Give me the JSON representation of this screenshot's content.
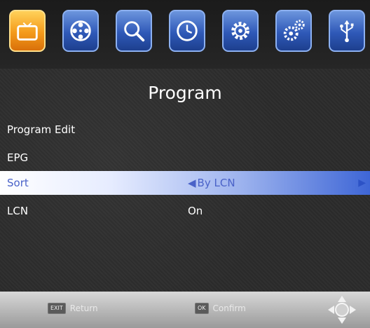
{
  "tabs": [
    {
      "icon": "tv-icon",
      "active": true
    },
    {
      "icon": "film-reel-icon",
      "active": false
    },
    {
      "icon": "search-icon",
      "active": false
    },
    {
      "icon": "clock-icon",
      "active": false
    },
    {
      "icon": "settings-gear-icon",
      "active": false
    },
    {
      "icon": "system-gears-icon",
      "active": false
    },
    {
      "icon": "usb-icon",
      "active": false
    }
  ],
  "menu": {
    "title": "Program",
    "items": [
      {
        "label": "Program Edit",
        "value": ""
      },
      {
        "label": "EPG",
        "value": ""
      },
      {
        "label": "Sort",
        "value": "By LCN"
      },
      {
        "label": "LCN",
        "value": "On"
      }
    ],
    "selected_index": 2
  },
  "footer": {
    "return_key": "EXIT",
    "return_label": "Return",
    "confirm_key": "OK",
    "confirm_label": "Confirm"
  },
  "colors": {
    "active_tab": "#f49a1a",
    "tab": "#2f59b8",
    "highlight": "#3e66d6"
  }
}
